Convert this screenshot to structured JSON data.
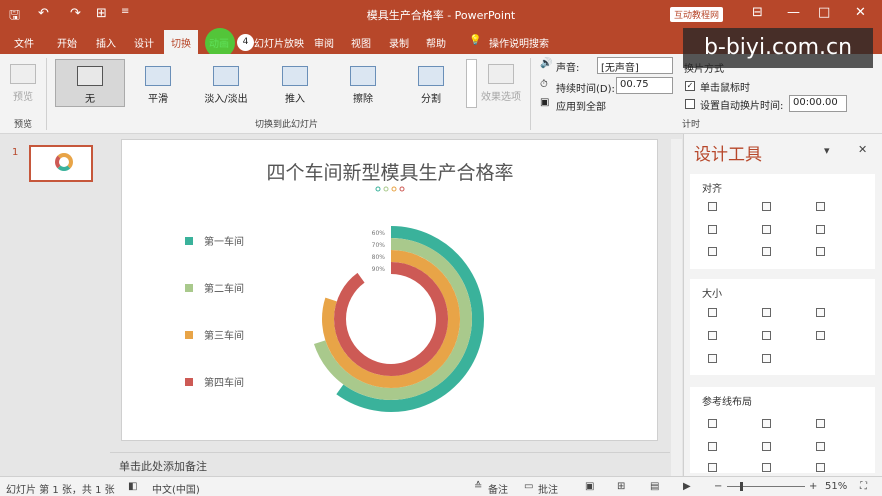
{
  "titlebar": {
    "title": "模具生产合格率 - PowerPoint",
    "badge": "互动教程网",
    "save_icon": "save-icon",
    "undo_icon": "undo-icon",
    "redo_icon": "redo-icon",
    "present_icon": "present-icon",
    "minimize": "—",
    "restore": "□",
    "close": "✕",
    "ribbon_options": "⊟",
    "customize": "≡"
  },
  "tabs": [
    "文件",
    "开始",
    "插入",
    "设计",
    "切换",
    "动画",
    "幻灯片放映",
    "审阅",
    "视图",
    "录制",
    "帮助",
    "操作说明搜索"
  ],
  "active_tab": "切换",
  "cursor_badge": "4",
  "watermark": "b-biyi.com.cn",
  "ribbon": {
    "preview_label": "预览",
    "preview_group": "预览",
    "transitions": [
      "无",
      "平滑",
      "淡入/淡出",
      "推入",
      "擦除",
      "分割"
    ],
    "transitions_group": "切换到此幻灯片",
    "effect_options": "效果选项",
    "sound_label": "声音:",
    "sound_value": "[无声音]",
    "duration_label": "持续时间(D):",
    "duration_value": "00.75",
    "apply_all": "应用到全部",
    "advance_label": "换片方式",
    "on_click": "单击鼠标时",
    "after_label": "设置自动换片时间:",
    "after_value": "00:00.00",
    "timing_group": "计时"
  },
  "thumbnail": {
    "number": "1"
  },
  "slide": {
    "title": "四个车间新型模具生产合格率"
  },
  "chart_data": {
    "type": "pie",
    "title": "四个车间新型模具生产合格率",
    "categories": [
      "第一车间",
      "第二车间",
      "第三车间",
      "第四车间"
    ],
    "values": [
      60,
      70,
      80,
      90
    ],
    "labels": [
      "60%",
      "70%",
      "80%",
      "90%"
    ],
    "colors": [
      "#3ab29b",
      "#a9c98c",
      "#e8a447",
      "#cd5a55"
    ],
    "legend_position": "left",
    "style": "concentric-rings"
  },
  "notes": "单击此处添加备注",
  "design_pane": {
    "title": "设计工具",
    "dropdown_icon": "▾",
    "close_icon": "✕",
    "sections": [
      "对齐",
      "大小",
      "参考线布局"
    ]
  },
  "statusbar": {
    "slide_info": "幻灯片 第 1 张，共 1 张",
    "language": "中文(中国)",
    "notes": "备注",
    "comments": "批注",
    "zoom": "51%",
    "minus": "−",
    "plus": "+"
  }
}
